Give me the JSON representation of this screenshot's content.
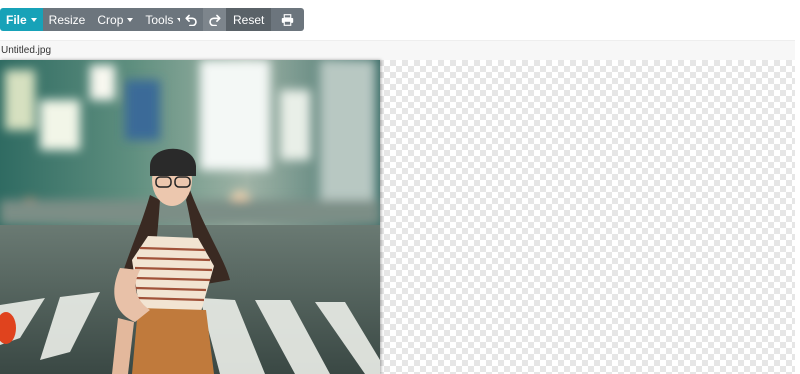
{
  "toolbar": {
    "file_label": "File",
    "resize_label": "Resize",
    "crop_label": "Crop",
    "tools_label": "Tools",
    "undo_icon": "undo-icon",
    "redo_icon": "redo-icon",
    "reset_label": "Reset",
    "print_icon": "print-icon"
  },
  "document": {
    "filename": "Untitled.jpg"
  },
  "colors": {
    "primary": "#17a2b8",
    "secondary": "#6c757d",
    "secondary_dark": "#5a6268",
    "checker_light": "#ffffff",
    "checker_dark": "#e6e6e6"
  }
}
